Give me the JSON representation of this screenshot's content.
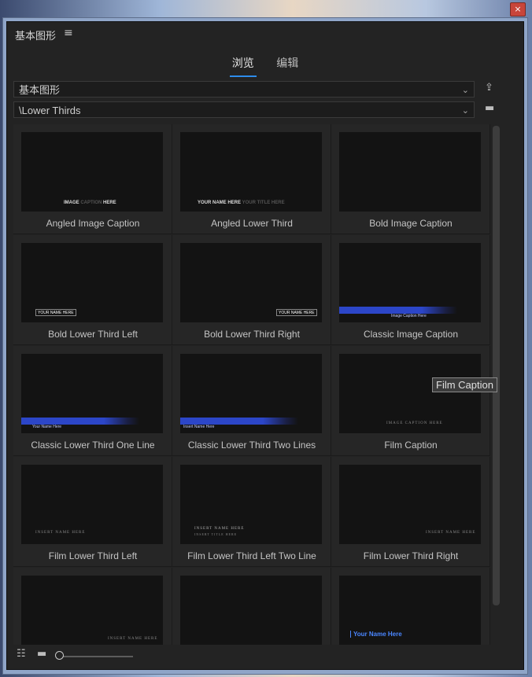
{
  "window": {
    "close_icon": "close-icon",
    "close_glyph": "×"
  },
  "panel": {
    "title": "基本图形",
    "menu_glyph": "≡"
  },
  "tabs": [
    {
      "label": "浏览",
      "active": true
    },
    {
      "label": "编辑",
      "active": false
    }
  ],
  "library_select": {
    "value": "基本图形"
  },
  "folder_select": {
    "value": "\\Lower Thirds"
  },
  "chevron": "⌄",
  "side_icons": {
    "import": "⇪",
    "folder": "▬"
  },
  "grid": [
    {
      "name": "Angled Image Caption",
      "preview": {
        "text_a": "IMAGE ",
        "text_b": "CAPTION",
        "text_c": " HERE"
      }
    },
    {
      "name": "Angled Lower Third",
      "preview": {
        "text_a": "YOUR NAME HERE ",
        "text_b": "YOUR TITLE HERE"
      }
    },
    {
      "name": "Bold Image Caption"
    },
    {
      "name": "Bold Lower Third Left",
      "preview": {
        "box": "YOUR NAME HERE"
      }
    },
    {
      "name": "Bold Lower Third Right",
      "preview": {
        "box": "YOUR NAME HERE"
      }
    },
    {
      "name": "Classic Image Caption",
      "preview": {
        "bar": "Image Caption Here"
      }
    },
    {
      "name": "Classic Lower Third One Line",
      "preview": {
        "bar": "Your Name Here"
      }
    },
    {
      "name": "Classic Lower Third Two Lines",
      "preview": {
        "bar": "Insert Name Here"
      }
    },
    {
      "name": "Film Caption",
      "preview": {
        "serif": "IMAGE CAPTION HERE"
      }
    },
    {
      "name": "Film Lower Third Left",
      "preview": {
        "serif": "INSERT NAME HERE"
      }
    },
    {
      "name": "Film Lower Third  Left Two Line",
      "preview": {
        "serif": "INSERT NAME HERE",
        "serif2": "INSERT TITLE HERE"
      }
    },
    {
      "name": "Film Lower Third Right",
      "preview": {
        "serif": "INSERT NAME HERE"
      }
    },
    {
      "name": "",
      "preview": {
        "serif": "INSERT NAME HERE"
      }
    },
    {
      "name": ""
    },
    {
      "name": "",
      "preview": {
        "blue": "Your Name Here"
      }
    }
  ],
  "tooltip": {
    "text": "Film Caption"
  },
  "bottom": {
    "list_view_icon": "☷",
    "thumb_view_icon": "▬"
  },
  "colors": {
    "accent": "#2d8ceb",
    "panel_bg": "#232323",
    "thumb_bg": "#131313"
  }
}
